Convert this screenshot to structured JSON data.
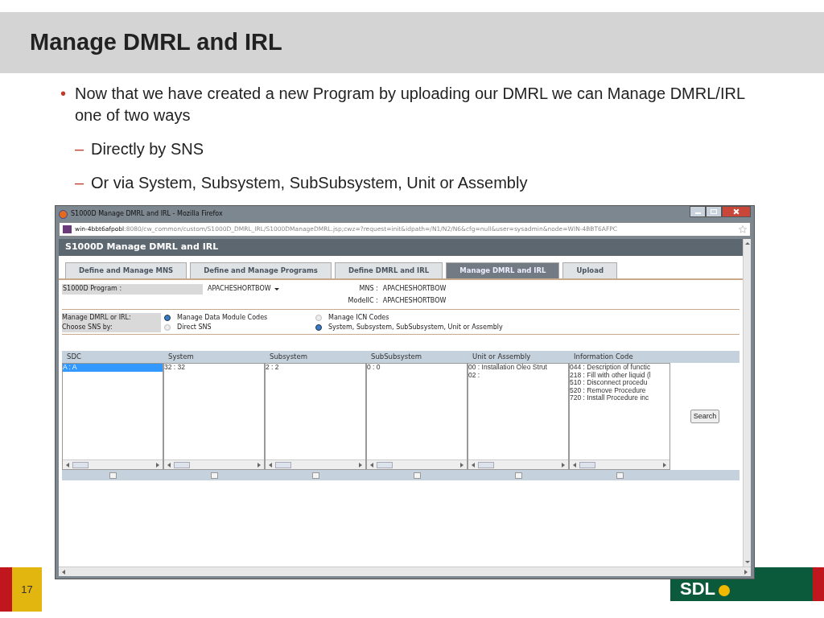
{
  "slide": {
    "title": "Manage DMRL and IRL",
    "bullets": [
      {
        "marker": "•",
        "text": "Now that we have created a new Program by uploading our DMRL we can Manage DMRL/IRL one of two ways",
        "children": [
          {
            "marker": "–",
            "text": "Directly by SNS"
          },
          {
            "marker": "–",
            "text": "Or via System, Subsystem, SubSubsystem, Unit or Assembly"
          }
        ]
      }
    ],
    "page_number": "17",
    "logo": "SDL"
  },
  "window": {
    "title": "S1000D Manage DMRL and IRL - Mozilla Firefox",
    "url_host": "win-4bbt6afpobl",
    "url_rest": ":8080/cw_common/custom/S1000D_DMRL_IRL/S1000DManageDMRL.jsp;cwz=?request=init&idpath=/N1/N2/N6&cfg=null&user=sysadmin&node=WIN-4BBT6AFPC",
    "app_title": "S1000D Manage DMRL and IRL",
    "tabs": [
      {
        "label": "Define and Manage MNS",
        "selected": false
      },
      {
        "label": "Define and Manage Programs",
        "selected": false
      },
      {
        "label": "Define DMRL and IRL",
        "selected": false
      },
      {
        "label": "Manage DMRL and IRL",
        "selected": true
      },
      {
        "label": "Upload",
        "selected": false
      }
    ],
    "program": {
      "label": "S1000D Program :",
      "value": "APACHESHORTBOW"
    },
    "mns": {
      "label": "MNS :",
      "value": "APACHESHORTBOW"
    },
    "modelic": {
      "label": "ModelIC :",
      "value": "APACHESHORTBOW"
    },
    "option_groups": [
      {
        "label": "Manage DMRL or IRL:",
        "options": [
          {
            "label": "Manage Data Module Codes",
            "selected": true
          },
          {
            "label": "Manage ICN Codes",
            "selected": false
          }
        ]
      },
      {
        "label": "Choose SNS by:",
        "options": [
          {
            "label": "Direct SNS",
            "selected": false
          },
          {
            "label": "System, Subsystem, SubSubsystem, Unit or Assembly",
            "selected": true
          }
        ]
      }
    ],
    "columns": [
      {
        "heading": "SDC",
        "checked": false,
        "items": [
          {
            "text": "A : A",
            "selected": true
          }
        ]
      },
      {
        "heading": "System",
        "checked": false,
        "items": [
          {
            "text": "32 : 32",
            "selected": false
          }
        ]
      },
      {
        "heading": "Subsystem",
        "checked": false,
        "items": [
          {
            "text": "2 : 2",
            "selected": false
          }
        ]
      },
      {
        "heading": "SubSubsystem",
        "checked": false,
        "items": [
          {
            "text": "0 : 0",
            "selected": false
          }
        ]
      },
      {
        "heading": "Unit or Assembly",
        "checked": false,
        "items": [
          {
            "text": "00 : Installation Oleo Strut",
            "selected": false
          },
          {
            "text": "02 :",
            "selected": false
          }
        ]
      },
      {
        "heading": "Information Code",
        "checked": false,
        "items": [
          {
            "text": "044 : Description of functic",
            "selected": false
          },
          {
            "text": "218 : Fill with other liquid (l",
            "selected": false
          },
          {
            "text": "510 : Disconnect procedu",
            "selected": false
          },
          {
            "text": "520 : Remove Procedure",
            "selected": false
          },
          {
            "text": "720 : Install Procedure inc",
            "selected": false
          }
        ]
      }
    ],
    "search_button": "Search"
  }
}
